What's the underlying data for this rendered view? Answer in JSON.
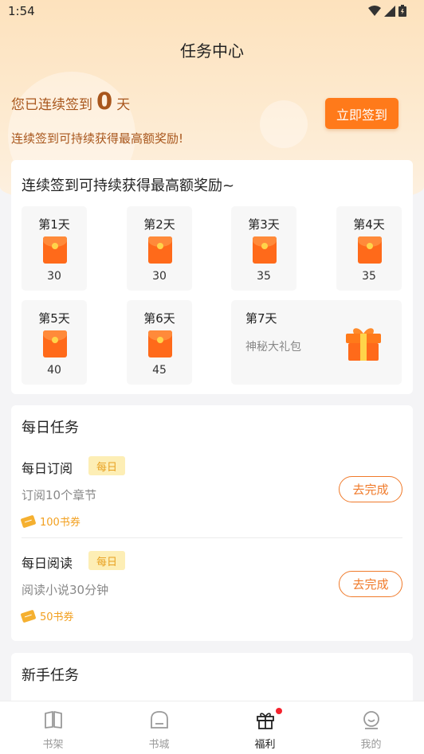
{
  "status_bar": {
    "time": "1:54"
  },
  "page": {
    "title": "任务中心"
  },
  "streak": {
    "prefix": "您已连续签到",
    "count": "0",
    "suffix": "天",
    "subtitle": "连续签到可持续获得最高额奖励!"
  },
  "checkin_button": "立即签到",
  "signin_card": {
    "heading": "连续签到可持续获得最高额奖励~",
    "days": [
      {
        "label": "第1天",
        "value": "30"
      },
      {
        "label": "第2天",
        "value": "30"
      },
      {
        "label": "第3天",
        "value": "35"
      },
      {
        "label": "第4天",
        "value": "35"
      },
      {
        "label": "第5天",
        "value": "40"
      },
      {
        "label": "第6天",
        "value": "45"
      }
    ],
    "day7": {
      "label": "第7天",
      "desc": "神秘大礼包"
    }
  },
  "daily": {
    "heading": "每日任务",
    "tasks": [
      {
        "name": "每日订阅",
        "badge": "每日",
        "desc": "订阅10个章节",
        "reward": "100书券",
        "action": "去完成"
      },
      {
        "name": "每日阅读",
        "badge": "每日",
        "desc": "阅读小说30分钟",
        "reward": "50书券",
        "action": "去完成"
      }
    ]
  },
  "newbie": {
    "heading": "新手任务"
  },
  "tabs": [
    {
      "label": "书架",
      "icon": "book-icon"
    },
    {
      "label": "书城",
      "icon": "bookstore-icon"
    },
    {
      "label": "福利",
      "icon": "gift-icon"
    },
    {
      "label": "我的",
      "icon": "profile-icon"
    }
  ],
  "colors": {
    "accent": "#ff7a1a",
    "streak_text": "#a8561c",
    "badge_bg": "#fdeeb5",
    "reward": "#f2a020"
  }
}
